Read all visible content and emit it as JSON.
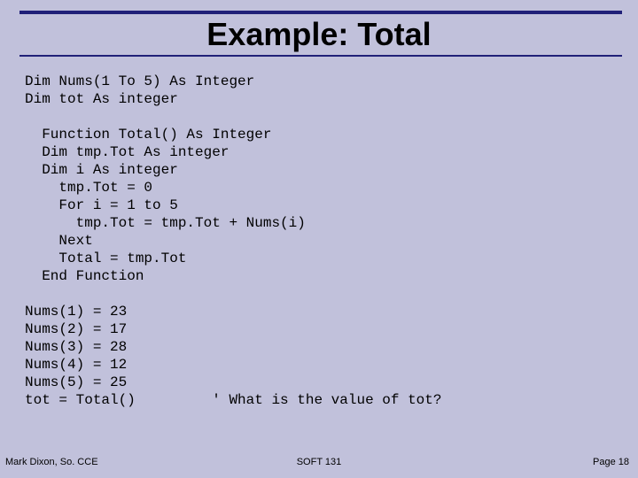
{
  "title": "Example: Total",
  "code": "Dim Nums(1 To 5) As Integer\nDim tot As integer\n\n  Function Total() As Integer\n  Dim tmp.Tot As integer\n  Dim i As integer\n    tmp.Tot = 0\n    For i = 1 to 5\n      tmp.Tot = tmp.Tot + Nums(i)\n    Next\n    Total = tmp.Tot\n  End Function\n\nNums(1) = 23\nNums(2) = 17\nNums(3) = 28\nNums(4) = 12\nNums(5) = 25\ntot = Total()         ' What is the value of tot?",
  "footer": {
    "left": "Mark Dixon, So. CCE",
    "center": "SOFT 131",
    "right": "Page 18"
  }
}
